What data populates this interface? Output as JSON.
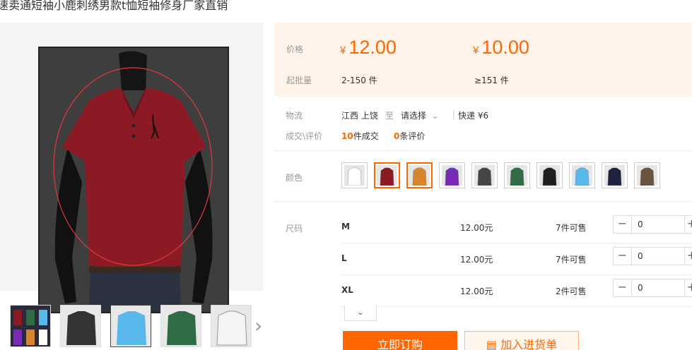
{
  "product": {
    "title": "速卖通短袖小鹿刺绣男款t恤短袖修身厂家直销"
  },
  "price": {
    "label": "价格",
    "yen": "¥",
    "tier1": "12.00",
    "tier2": "10.00",
    "moq_label": "起批量",
    "tier1_range": "2-150 件",
    "tier2_range": "≥151 件"
  },
  "logistics": {
    "label": "物流",
    "origin": "江西 上饶",
    "to": "至",
    "select": "请选择",
    "express": "快递 ¥6"
  },
  "sales": {
    "label": "成交\\评价",
    "deals_count": "10",
    "deals_text": "件成交",
    "reviews_count": "0",
    "reviews_text": "条评价"
  },
  "color": {
    "label": "颜色",
    "colors": [
      "#ffffff",
      "#8b1a24",
      "#d8852e",
      "#7a2ab8",
      "#444444",
      "#2f6b45",
      "#1f1f1f",
      "#58b8ec",
      "#1c2340",
      "#6a5440"
    ]
  },
  "sizes": {
    "label": "尺码",
    "rows": [
      {
        "name": "M",
        "price": "12.00元",
        "avail": "7件可售",
        "qty": "0"
      },
      {
        "name": "L",
        "price": "12.00元",
        "avail": "7件可售",
        "qty": "0"
      },
      {
        "name": "XL",
        "price": "12.00元",
        "avail": "2件可售",
        "qty": "0"
      }
    ]
  },
  "buttons": {
    "buy": "立即订购",
    "cart": "加入进货单"
  },
  "icons": {
    "expand": "chevron-down-icon",
    "prev": "chevron-left-icon",
    "next": "chevron-right-icon",
    "cart": "list-icon"
  },
  "thumbnails": [
    "#2a2a3a",
    "#333333",
    "#58b8ec",
    "#2f6b45",
    "#f0f0f0"
  ]
}
